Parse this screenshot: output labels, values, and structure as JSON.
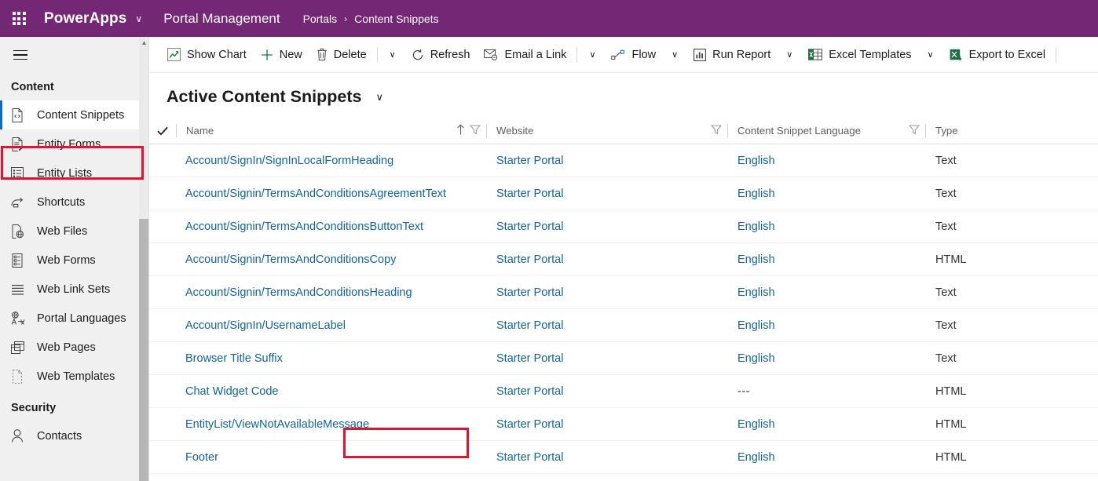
{
  "topbar": {
    "waffle_icon": "app-launcher-icon",
    "brand": "PowerApps",
    "brand_chevron": "∨",
    "app_name": "Portal Management",
    "breadcrumb": {
      "root": "Portals",
      "separator": "›",
      "current": "Content Snippets"
    },
    "background_color": "#742774"
  },
  "sidebar": {
    "hamburger_icon": "hamburger-menu-icon",
    "groups": [
      {
        "title": "Content",
        "items": [
          {
            "label": "Content Snippets",
            "icon": "code-file-icon",
            "selected": true
          },
          {
            "label": "Entity Forms",
            "icon": "form-edit-icon",
            "selected": false
          },
          {
            "label": "Entity Lists",
            "icon": "list-icon",
            "selected": false
          },
          {
            "label": "Shortcuts",
            "icon": "shortcut-arrow-icon",
            "selected": false
          },
          {
            "label": "Web Files",
            "icon": "web-file-icon",
            "selected": false
          },
          {
            "label": "Web Forms",
            "icon": "web-form-icon",
            "selected": false
          },
          {
            "label": "Web Link Sets",
            "icon": "link-lines-icon",
            "selected": false
          },
          {
            "label": "Portal Languages",
            "icon": "language-icon",
            "selected": false
          },
          {
            "label": "Web Pages",
            "icon": "pages-icon",
            "selected": false
          },
          {
            "label": "Web Templates",
            "icon": "template-icon",
            "selected": false
          }
        ]
      },
      {
        "title": "Security",
        "items": [
          {
            "label": "Contacts",
            "icon": "person-icon",
            "selected": false
          }
        ]
      }
    ],
    "scrollbar": {
      "up_arrow_icon": "chevron-up-icon"
    },
    "selected_accent_color": "#0f6cbd"
  },
  "commandbar": {
    "commands": [
      {
        "label": "Show Chart",
        "icon": "chart-icon",
        "chevron": false
      },
      {
        "label": "New",
        "icon": "plus-icon",
        "chevron": false
      },
      {
        "label": "Delete",
        "icon": "trash-icon",
        "chevron": true
      },
      {
        "label": "Refresh",
        "icon": "refresh-icon",
        "chevron": false
      },
      {
        "label": "Email a Link",
        "icon": "email-link-icon",
        "chevron": true
      },
      {
        "label": "Flow",
        "icon": "flow-icon",
        "chevron": true
      },
      {
        "label": "Run Report",
        "icon": "report-icon",
        "chevron": true
      },
      {
        "label": "Excel Templates",
        "icon": "excel-template-icon",
        "chevron": true
      },
      {
        "label": "Export to Excel",
        "icon": "excel-export-icon",
        "chevron": false
      }
    ]
  },
  "view": {
    "title": "Active Content Snippets",
    "chevron_icon": "chevron-down-icon"
  },
  "grid": {
    "select_all_icon": "checkmark-icon",
    "sort_icon": "sort-ascending-icon",
    "filter_icon": "filter-icon",
    "columns": [
      {
        "key": "name",
        "label": "Name",
        "sorted": true,
        "filter": true
      },
      {
        "key": "website",
        "label": "Website",
        "sorted": false,
        "filter": true
      },
      {
        "key": "language",
        "label": "Content Snippet Language",
        "sorted": false,
        "filter": true
      },
      {
        "key": "type",
        "label": "Type",
        "sorted": false,
        "filter": false
      }
    ],
    "rows": [
      {
        "name": "Account/SignIn/SignInLocalFormHeading",
        "website": "Starter Portal",
        "language": "English",
        "type": "Text",
        "highlighted": false
      },
      {
        "name": "Account/Signin/TermsAndConditionsAgreementText",
        "website": "Starter Portal",
        "language": "English",
        "type": "Text",
        "highlighted": false
      },
      {
        "name": "Account/Signin/TermsAndConditionsButtonText",
        "website": "Starter Portal",
        "language": "English",
        "type": "Text",
        "highlighted": false
      },
      {
        "name": "Account/Signin/TermsAndConditionsCopy",
        "website": "Starter Portal",
        "language": "English",
        "type": "HTML",
        "highlighted": false
      },
      {
        "name": "Account/Signin/TermsAndConditionsHeading",
        "website": "Starter Portal",
        "language": "English",
        "type": "Text",
        "highlighted": false
      },
      {
        "name": "Account/SignIn/UsernameLabel",
        "website": "Starter Portal",
        "language": "English",
        "type": "Text",
        "highlighted": false
      },
      {
        "name": "Browser Title Suffix",
        "website": "Starter Portal",
        "language": "English",
        "type": "Text",
        "highlighted": false
      },
      {
        "name": "Chat Widget Code",
        "website": "Starter Portal",
        "language": "---",
        "type": "HTML",
        "highlighted": true
      },
      {
        "name": "EntityList/ViewNotAvailableMessage",
        "website": "Starter Portal",
        "language": "English",
        "type": "HTML",
        "highlighted": false
      },
      {
        "name": "Footer",
        "website": "Starter Portal",
        "language": "English",
        "type": "HTML",
        "highlighted": false
      }
    ]
  },
  "annotations": {
    "highlight_color": "#e8112d",
    "boxes": [
      {
        "target": "sidebar-item-content-snippets"
      },
      {
        "target": "row-link-chat-widget-code"
      }
    ]
  },
  "colors": {
    "link": "#11659b",
    "text": "#323130",
    "header_purple": "#742774"
  }
}
